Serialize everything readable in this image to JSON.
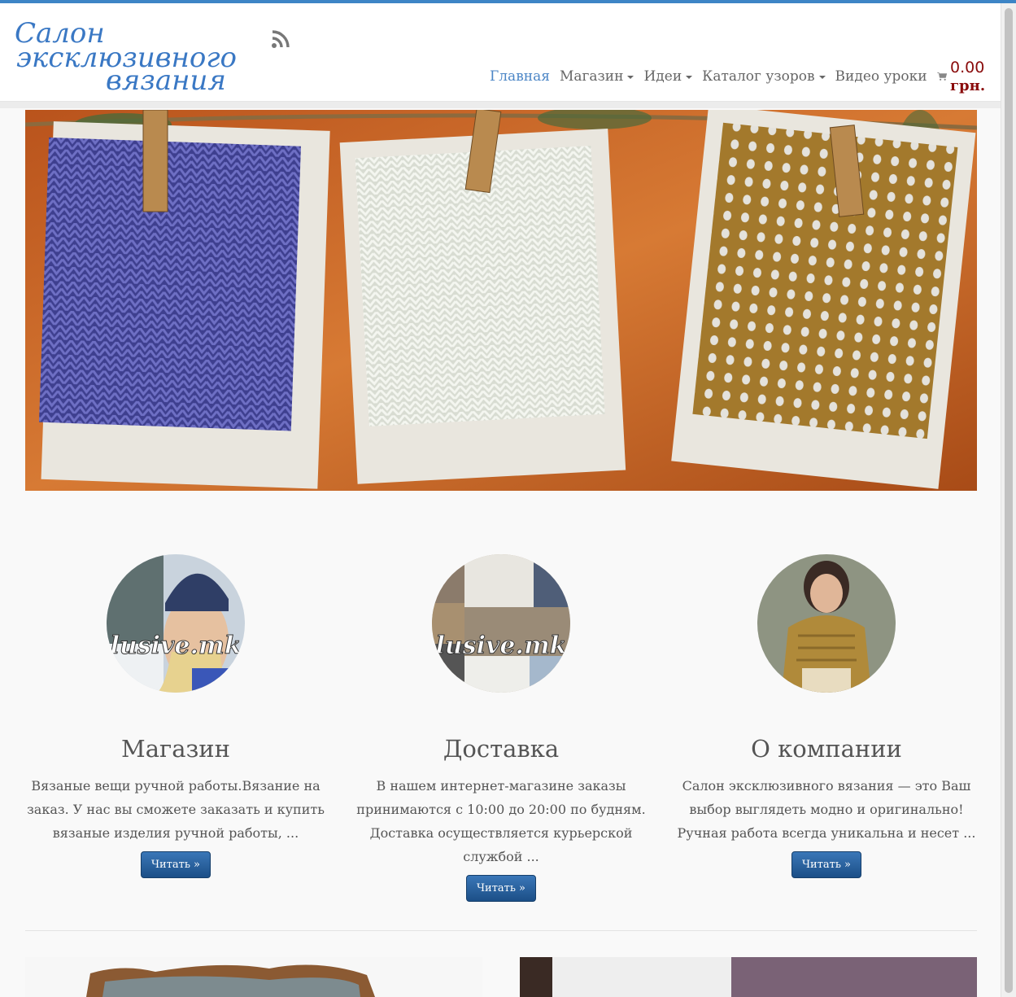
{
  "site": {
    "logo_line1": "Салон",
    "logo_line2": "эксклюзивного",
    "logo_line3": "вязания",
    "logo_alt": "Салон эксклюзивного вязания"
  },
  "nav": {
    "items": [
      {
        "label": "Главная",
        "dropdown": false,
        "active": true
      },
      {
        "label": "Магазин",
        "dropdown": true
      },
      {
        "label": "Идеи",
        "dropdown": true
      },
      {
        "label": "Каталог узоров",
        "dropdown": true
      },
      {
        "label": "Видео уроки",
        "dropdown": false
      }
    ],
    "cart_amount": "0.00",
    "cart_currency": "грн."
  },
  "columns": [
    {
      "title": "Магазин",
      "text": "Вязаные вещи ручной работы.Вязание на заказ. У нас вы сможете заказать и купить вязаные изделия ручной работы, ...",
      "button": "Читать »",
      "watermark": "lusive.mk"
    },
    {
      "title": "Доставка",
      "text": "В нашем интернет-магазине заказы принимаются с 10:00 до 20:00 по будням. Доставка осуществляется курьерской службой ...",
      "button": "Читать »",
      "watermark": "lusive.mk"
    },
    {
      "title": "О компании",
      "text": "Салон эксклюзивного вязания — это Ваш выбор выглядеть модно и оригинально! Ручная работа всегда уникальна и несет ...",
      "button": "Читать »"
    }
  ],
  "colors": {
    "accent": "#3d85c6",
    "cart": "#8a0b0b",
    "button": "#1c4f87"
  }
}
